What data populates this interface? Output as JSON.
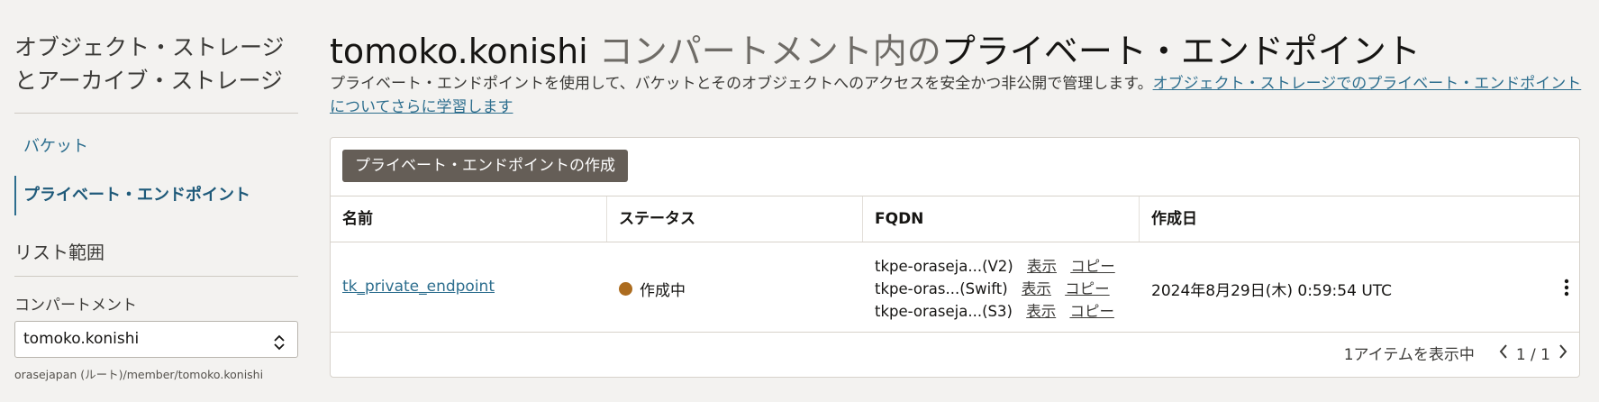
{
  "sidebar": {
    "title_line1": "オブジェクト・ストレージ",
    "title_line2": "とアーカイブ・ストレージ",
    "items": [
      {
        "label": "バケット"
      },
      {
        "label": "プライベート・エンドポイント"
      }
    ],
    "scope_title": "リスト範囲",
    "compartment_label": "コンパートメント",
    "compartment_value": "tomoko.konishi",
    "compartment_path": "orasejapan (ルート)/member/tomoko.konishi"
  },
  "header": {
    "title_user": "tomoko.konishi",
    "title_mid": " コンパートメント内の",
    "title_rest": "プライベート・エンドポイント",
    "description": "プライベート・エンドポイントを使用して、バケットとそのオブジェクトへのアクセスを安全かつ非公開で管理します。",
    "description_link": "オブジェクト・ストレージでのプライベート・エンドポイントについてさらに学習します"
  },
  "toolbar": {
    "create_label": "プライベート・エンドポイントの作成"
  },
  "table": {
    "columns": [
      "名前",
      "ステータス",
      "FQDN",
      "作成日"
    ],
    "rows": [
      {
        "name": "tk_private_endpoint",
        "status": "作成中",
        "fqdn": [
          {
            "text": "tkpe-oraseja...(V2)",
            "show": "表示",
            "copy": "コピー"
          },
          {
            "text": "tkpe-oras...(Swift)",
            "show": "表示",
            "copy": "コピー"
          },
          {
            "text": "tkpe-oraseja...(S3)",
            "show": "表示",
            "copy": "コピー"
          }
        ],
        "created": "2024年8月29日(木) 0:59:54 UTC"
      }
    ]
  },
  "footer": {
    "items_shown": "1アイテムを表示中",
    "page_indicator": "1 / 1"
  },
  "colors": {
    "accent": "#2d6e8e",
    "status_creating": "#ac6c1f",
    "button_bg": "#655e57"
  }
}
